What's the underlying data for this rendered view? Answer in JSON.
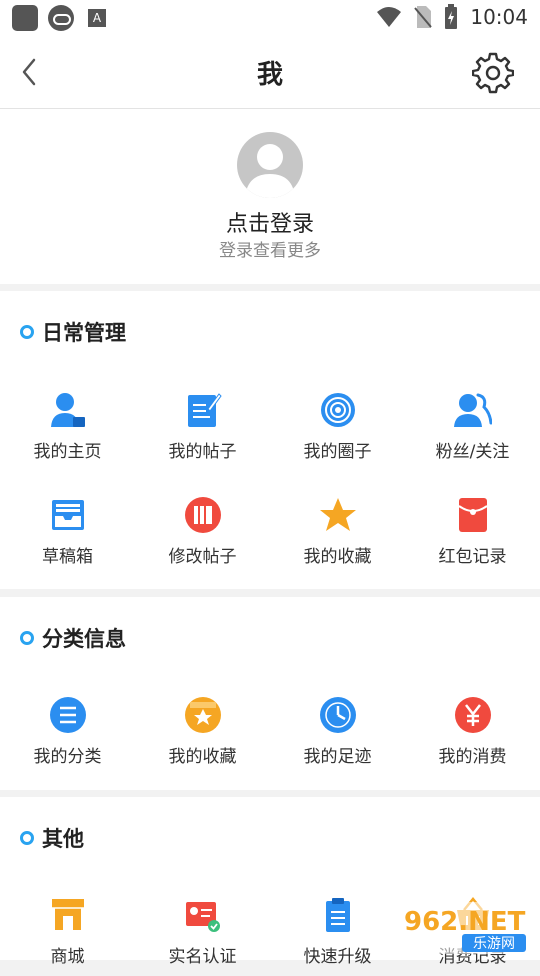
{
  "status_bar": {
    "time": "10:04"
  },
  "header": {
    "title": "我"
  },
  "profile": {
    "login_title": "点击登录",
    "login_subtitle": "登录查看更多"
  },
  "sections": {
    "daily": {
      "title": "日常管理",
      "items": [
        {
          "label": "我的主页",
          "icon": "user-home-icon"
        },
        {
          "label": "我的帖子",
          "icon": "edit-note-icon"
        },
        {
          "label": "我的圈子",
          "icon": "circle-target-icon"
        },
        {
          "label": "粉丝/关注",
          "icon": "users-icon"
        },
        {
          "label": "草稿箱",
          "icon": "inbox-tray-icon"
        },
        {
          "label": "修改帖子",
          "icon": "books-icon"
        },
        {
          "label": "我的收藏",
          "icon": "star-icon"
        },
        {
          "label": "红包记录",
          "icon": "red-envelope-icon"
        }
      ]
    },
    "category": {
      "title": "分类信息",
      "items": [
        {
          "label": "我的分类",
          "icon": "list-icon"
        },
        {
          "label": "我的收藏",
          "icon": "star-badge-icon"
        },
        {
          "label": "我的足迹",
          "icon": "clock-icon"
        },
        {
          "label": "我的消费",
          "icon": "yen-icon"
        }
      ]
    },
    "other": {
      "title": "其他",
      "items": [
        {
          "label": "商城",
          "icon": "shop-icon"
        },
        {
          "label": "实名认证",
          "icon": "id-card-icon"
        },
        {
          "label": "快速升级",
          "icon": "clipboard-icon"
        },
        {
          "label": "消费记录",
          "icon": "basket-icon"
        }
      ]
    }
  },
  "watermark": {
    "brand": "962.NET",
    "sub": "乐游网"
  },
  "colors": {
    "accent": "#29a3f0",
    "blue": "#2b8ef0",
    "orange": "#f5a623",
    "red": "#f04a3e"
  }
}
